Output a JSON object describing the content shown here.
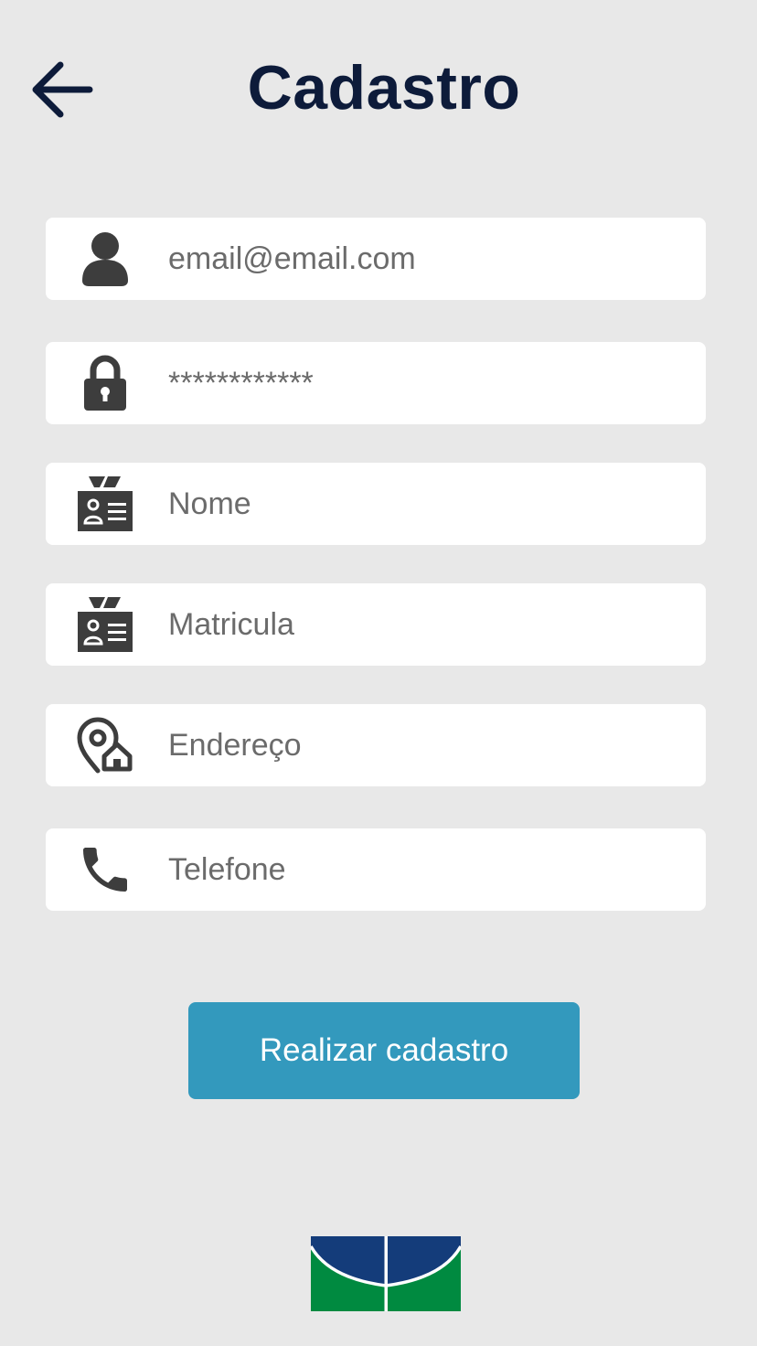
{
  "header": {
    "title": "Cadastro",
    "back_icon": "arrow-left-icon"
  },
  "form": {
    "email": {
      "icon": "user-icon",
      "placeholder": "email@email.com"
    },
    "password": {
      "icon": "lock-icon",
      "placeholder": "************"
    },
    "name": {
      "icon": "id-badge-icon",
      "placeholder": "Nome"
    },
    "registration": {
      "icon": "id-badge-icon",
      "placeholder": "Matricula"
    },
    "address": {
      "icon": "location-home-icon",
      "placeholder": "Endereço"
    },
    "phone": {
      "icon": "phone-icon",
      "placeholder": "Telefone"
    }
  },
  "actions": {
    "submit_label": "Realizar cadastro"
  },
  "footer": {
    "logo": "university-logo"
  },
  "colors": {
    "background": "#e8e8e8",
    "title": "#0d1b3a",
    "icon": "#3d3d3d",
    "input_text": "#6b6b6b",
    "button": "#3399bd",
    "logo_blue": "#143c7a",
    "logo_green": "#008a40"
  }
}
